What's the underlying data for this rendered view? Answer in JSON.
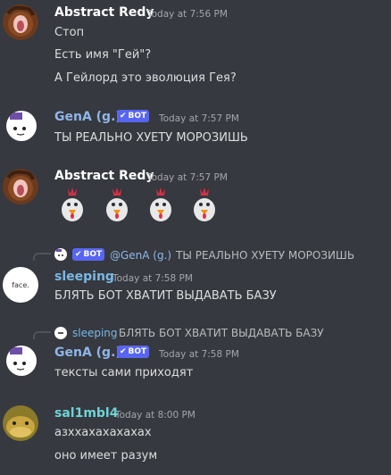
{
  "messages": [
    {
      "author": "Abstract Redy",
      "author_color": "#ffffff",
      "time": "Today at 7:56 PM",
      "lines": [
        "Стоп",
        "Есть имя \"Гей\"?",
        "А Гейлорд это эволюция Гея?"
      ]
    },
    {
      "author": "GenA (g.)",
      "author_color": "#8fb6e8",
      "bot_label": "BOT",
      "time": "Today at 7:57 PM",
      "lines": [
        "ТЫ РЕАЛЬНО ХУЕТУ МОРОЗИШЬ"
      ]
    },
    {
      "author": "Abstract Redy",
      "author_color": "#ffffff",
      "time": "Today at 7:57 PM",
      "emoji": [
        "chicken-icon",
        "chicken-icon",
        "chicken-icon",
        "chicken-icon"
      ]
    },
    {
      "reply": {
        "bot_label": "BOT",
        "name": "@GenA (g.)",
        "text": "ТЫ РЕАЛЬНО ХУЕТУ МОРОЗИШЬ"
      },
      "author": "sleeping",
      "author_color": "#7ab8e6",
      "avatar_text": "face.",
      "time": "Today at 7:58 PM",
      "lines": [
        "БЛЯТЬ БОТ ХВАТИТ ВЫДАВАТЬ БАЗУ"
      ]
    },
    {
      "reply": {
        "name": "sleeping",
        "text": "БЛЯТЬ БОТ ХВАТИТ ВЫДАВАТЬ БАЗУ"
      },
      "author": "GenA (g.)",
      "author_color": "#8fb6e8",
      "bot_label": "BOT",
      "time": "Today at 7:58 PM",
      "lines": [
        "тексты сами приходят"
      ]
    },
    {
      "author": "sal1mbl4",
      "author_color": "#6fd3d8",
      "time": "Today at 8:00 PM",
      "lines": [
        "азххахахахахах",
        "оно имеет разум"
      ]
    }
  ],
  "colors": {
    "background": "#36393f",
    "bot_badge": "#5865f2",
    "timestamp": "#a3a6aa",
    "reply_text": "#b9bbbe"
  }
}
